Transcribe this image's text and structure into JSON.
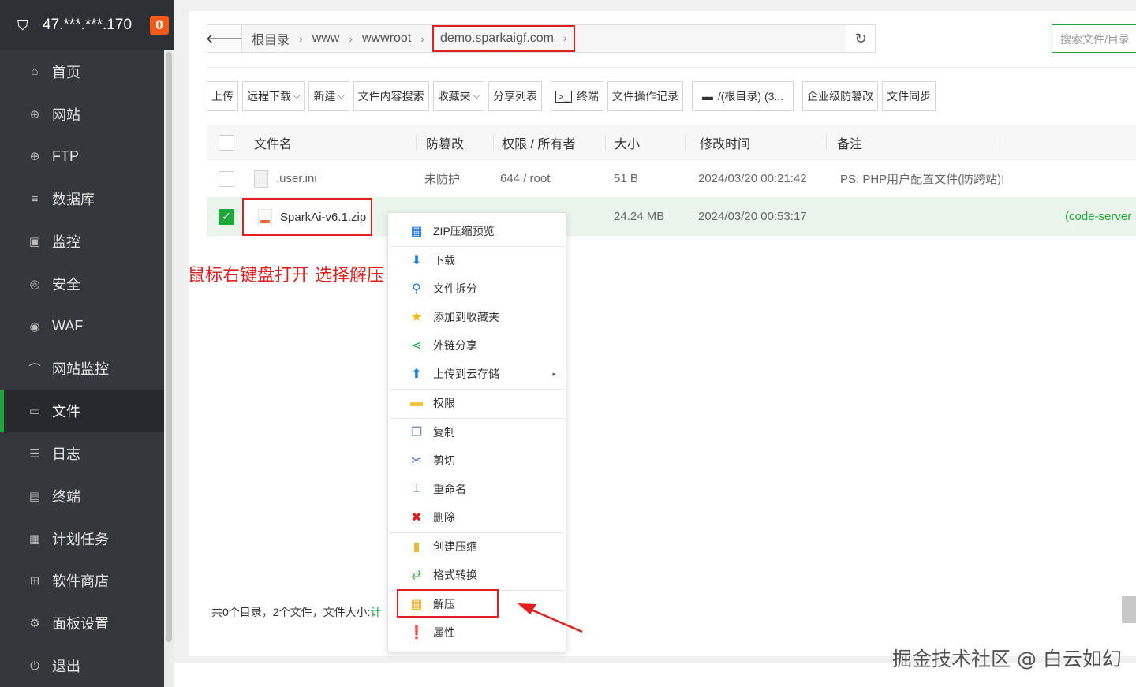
{
  "sidebar": {
    "ip": "47.***.***.170",
    "badge": "0",
    "items": [
      {
        "label": "首页",
        "icon": "home-icon",
        "glyph": "⌂"
      },
      {
        "label": "网站",
        "icon": "globe-icon",
        "glyph": "⊕"
      },
      {
        "label": "FTP",
        "icon": "ftp-globe-icon",
        "glyph": "⊕"
      },
      {
        "label": "数据库",
        "icon": "database-icon",
        "glyph": "≡"
      },
      {
        "label": "监控",
        "icon": "monitor-icon",
        "glyph": "▣"
      },
      {
        "label": "安全",
        "icon": "shield-icon",
        "glyph": "◎"
      },
      {
        "label": "WAF",
        "icon": "waf-shield-icon",
        "glyph": "◉"
      },
      {
        "label": "网站监控",
        "icon": "chart-line-icon",
        "glyph": "⌒"
      },
      {
        "label": "文件",
        "icon": "folder-icon",
        "glyph": "▭"
      },
      {
        "label": "日志",
        "icon": "log-icon",
        "glyph": "☰"
      },
      {
        "label": "终端",
        "icon": "terminal-icon",
        "glyph": "▤"
      },
      {
        "label": "计划任务",
        "icon": "calendar-icon",
        "glyph": "▦"
      },
      {
        "label": "软件商店",
        "icon": "apps-icon",
        "glyph": "⊞"
      },
      {
        "label": "面板设置",
        "icon": "settings-icon",
        "glyph": "⚙"
      },
      {
        "label": "退出",
        "icon": "logout-icon",
        "glyph": "⏻"
      }
    ]
  },
  "path": {
    "back_glyph": "🡐",
    "crumbs": [
      "根目录",
      "www",
      "wwwroot"
    ],
    "current": "demo.sparkaigf.com",
    "refresh_glyph": "↻"
  },
  "search": {
    "placeholder": "搜索文件/目录"
  },
  "toolbar": {
    "buttons": [
      "上传",
      "远程下载",
      "新建",
      "文件内容搜索",
      "收藏夹",
      "分享列表",
      "终端",
      "文件操作记录",
      "/(根目录) (3...",
      "企业级防篡改",
      "文件同步"
    ]
  },
  "table": {
    "headers": [
      "文件名",
      "防篡改",
      "权限 / 所有者",
      "大小",
      "修改时间",
      "备注"
    ],
    "rows": [
      {
        "name": ".user.ini",
        "tamper": "未防护",
        "perm": "644 / root",
        "size": "51 B",
        "mtime": "2024/03/20 00:21:42",
        "note": "PS: PHP用户配置文件(防跨站)!",
        "tag": ""
      },
      {
        "name": "SparkAi-v6.1.zip",
        "tamper": "",
        "perm": "",
        "size": "24.24 MB",
        "mtime": "2024/03/20 00:53:17",
        "note": "",
        "tag": "(code-server"
      }
    ]
  },
  "annotation": "鼠标右键盘打开 选择解压",
  "footer": {
    "summary": "共0个目录，2个文件，文件大小:",
    "link": "计"
  },
  "context_menu": {
    "items": [
      {
        "label": "ZIP压缩预览",
        "icon": "zip-preview-icon",
        "glyph": "▦",
        "color": "#2a7de1"
      },
      {
        "label": "下载",
        "icon": "download-arrow-icon",
        "glyph": "⬇",
        "color": "#2a7de1"
      },
      {
        "label": "文件拆分",
        "icon": "magnifier-icon",
        "glyph": "⚲",
        "color": "#2a7de1"
      },
      {
        "label": "添加到收藏夹",
        "icon": "star-icon",
        "glyph": "★",
        "color": "#f5b400"
      },
      {
        "label": "外链分享",
        "icon": "share-icon",
        "glyph": "⋖",
        "color": "#20a53a"
      },
      {
        "label": "上传到云存储",
        "icon": "upload-arrow-icon",
        "glyph": "⬆",
        "color": "#2a7de1"
      },
      {
        "label": "权限",
        "icon": "permission-folder-icon",
        "glyph": "▬",
        "color": "#f0c040"
      },
      {
        "label": "复制",
        "icon": "copy-icon",
        "glyph": "❐",
        "color": "#7a8fb0"
      },
      {
        "label": "剪切",
        "icon": "scissors-icon",
        "glyph": "✂",
        "color": "#4a6fb5"
      },
      {
        "label": "重命名",
        "icon": "rename-icon",
        "glyph": "⌶",
        "color": "#4a6fb5"
      },
      {
        "label": "删除",
        "icon": "delete-x-icon",
        "glyph": "✖",
        "color": "#e02020"
      },
      {
        "label": "创建压缩",
        "icon": "compress-icon",
        "glyph": "▮",
        "color": "#e8b830"
      },
      {
        "label": "格式转换",
        "icon": "convert-icon",
        "glyph": "⇄",
        "color": "#20a53a"
      },
      {
        "label": "解压",
        "icon": "unzip-icon",
        "glyph": "▦",
        "color": "#e8b830"
      },
      {
        "label": "属性",
        "icon": "info-icon",
        "glyph": "❗",
        "color": "#666"
      }
    ],
    "submenu_glyph": "▸"
  },
  "watermark": "掘金技术社区 @ 白云如幻",
  "colors": {
    "accent": "#20a53a",
    "highlight": "#e02020",
    "sidebar_bg": "#34383d"
  }
}
